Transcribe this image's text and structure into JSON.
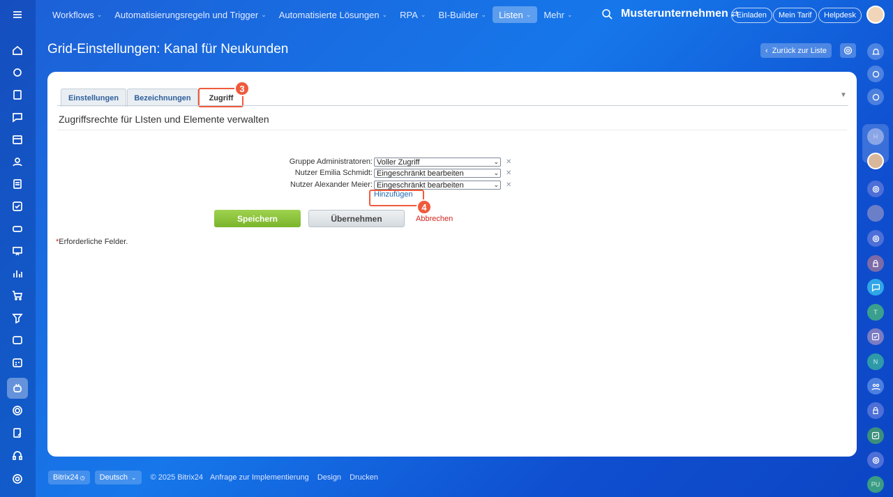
{
  "nav": {
    "items": [
      {
        "label": "Workflows",
        "chevron": true
      },
      {
        "label": "Automatisierungsregeln und Trigger",
        "chevron": true
      },
      {
        "label": "Automatisierte Lösungen",
        "chevron": true
      },
      {
        "label": "RPA",
        "chevron": true
      },
      {
        "label": "BI-Builder",
        "chevron": true
      },
      {
        "label": "Listen",
        "chevron": true,
        "active": true
      },
      {
        "label": "Mehr",
        "chevron": true
      }
    ],
    "company": "Musterunternehmen",
    "invite": "Einladen",
    "my_plan": "Mein Tarif",
    "helpdesk": "Helpdesk"
  },
  "page": {
    "title": "Grid-Einstellungen: Kanal für Neukunden",
    "back_label": "Zurück zur Liste"
  },
  "tabs": [
    {
      "label": "Einstellungen"
    },
    {
      "label": "Bezeichnungen"
    },
    {
      "label": "Zugriff",
      "active": true
    }
  ],
  "section_title": "Zugriffsrechte für LIsten und Elemente verwalten",
  "access_rows": [
    {
      "label": "Gruppe Administratoren:",
      "value": "Voller Zugriff"
    },
    {
      "label": "Nutzer Emilia Schmidt:",
      "value": "Eingeschränkt bearbeiten"
    },
    {
      "label": "Nutzer Alexander Meier:",
      "value": "Eingeschränkt bearbeiten"
    }
  ],
  "add_link": "Hinzufügen",
  "buttons": {
    "save": "Speichern",
    "apply": "Übernehmen",
    "cancel": "Abbrechen"
  },
  "required_note": {
    "star": "*",
    "text": "Erforderliche Felder."
  },
  "badges": {
    "tab": "3",
    "add": "4"
  },
  "footer": {
    "brand": "Bitrix24",
    "language": "Deutsch",
    "copyright": "© 2025 Bitrix24",
    "links": [
      "Anfrage zur Implementierung",
      "Design",
      "Drucken"
    ]
  },
  "right_bar_letters": {
    "h": "H",
    "t": "T",
    "n": "N",
    "pu": "PU"
  },
  "colors": {
    "accent": "#ef5a3c",
    "save": "#8cc63f",
    "link": "#2067b0",
    "cancel": "#d0241c"
  }
}
